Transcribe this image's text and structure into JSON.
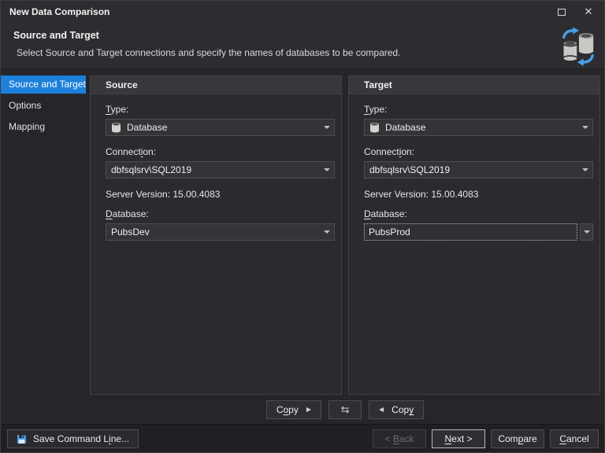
{
  "window": {
    "title": "New Data Comparison",
    "close_glyph": "✕"
  },
  "header": {
    "title": "Source and Target",
    "description": "Select Source and Target connections and specify the names of databases to be compared."
  },
  "sidebar": {
    "items": [
      {
        "label": "Source and Target",
        "selected": true
      },
      {
        "label": "Options",
        "selected": false
      },
      {
        "label": "Mapping",
        "selected": false
      }
    ]
  },
  "source": {
    "title": "Source",
    "type_label": {
      "pre": "",
      "u": "T",
      "post": "ype:"
    },
    "type_value": "Database",
    "connection_label": {
      "pre": "Connect",
      "u": "i",
      "post": "on:"
    },
    "connection_value": "dbfsqlsrv\\SQL2019",
    "server_version_label": "Server Version: 15.00.4083",
    "database_label": {
      "pre": "",
      "u": "D",
      "post": "atabase:"
    },
    "database_value": "PubsDev"
  },
  "target": {
    "title": "Target",
    "type_label": {
      "pre": "",
      "u": "T",
      "post": "ype:"
    },
    "type_value": "Database",
    "connection_label": {
      "pre": "Connect",
      "u": "i",
      "post": "on:"
    },
    "connection_value": "dbfsqlsrv\\SQL2019",
    "server_version_label": "Server Version: 15.00.4083",
    "database_label": {
      "pre": "",
      "u": "D",
      "post": "atabase:"
    },
    "database_value": "PubsProd"
  },
  "copy_bar": {
    "copy_to_target": {
      "pre": "C",
      "u": "o",
      "post": "py"
    },
    "arrow_right": "▶",
    "swap_glyph": "⇆",
    "arrow_left": "◀",
    "copy_to_source": {
      "pre": "Cop",
      "u": "y",
      "post": ""
    }
  },
  "footer": {
    "save_command_line": {
      "pre": "Save Command L",
      "u": "i",
      "post": "ne..."
    },
    "back": {
      "pre": "< ",
      "u": "B",
      "post": "ack"
    },
    "next": {
      "pre": "",
      "u": "N",
      "post": "ext >"
    },
    "compare": {
      "pre": "Com",
      "u": "p",
      "post": "are"
    },
    "cancel": {
      "pre": "",
      "u": "C",
      "post": "ancel"
    }
  },
  "colors": {
    "accent_blue": "#1c80da",
    "icon_blue": "#4aa0e8",
    "icon_gray": "#c8c8c5"
  }
}
